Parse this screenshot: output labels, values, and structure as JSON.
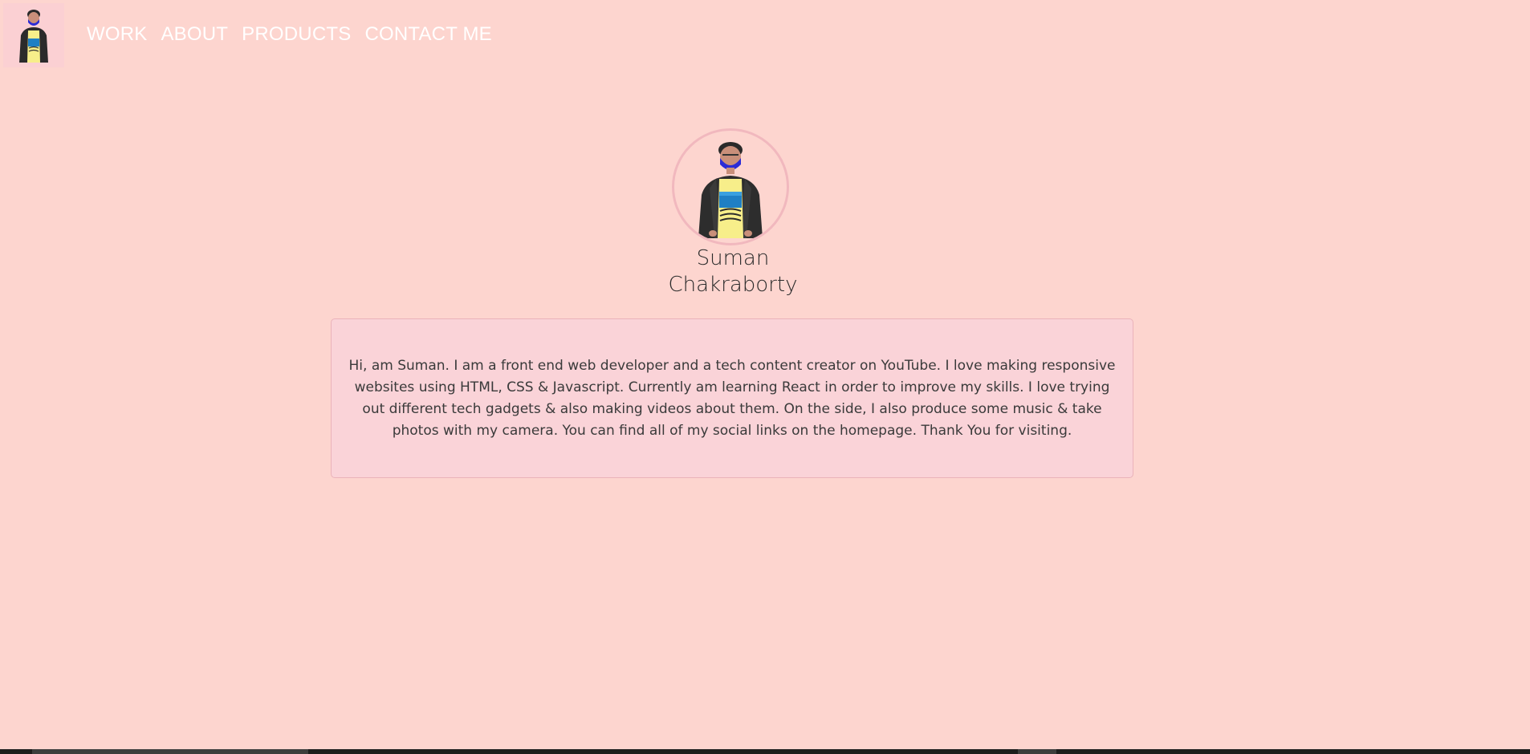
{
  "nav": {
    "logo_icon": "avatar-icon",
    "links": [
      {
        "label": "WORK"
      },
      {
        "label": "ABOUT"
      },
      {
        "label": "PRODUCTS"
      },
      {
        "label": "CONTACT ME"
      }
    ]
  },
  "profile": {
    "photo_icon": "avatar-icon",
    "name_line1": "Suman",
    "name_line2": "Chakraborty"
  },
  "bio": {
    "text": "Hi, am Suman. I am a front end web developer and a tech content creator on YouTube. I love making responsive websites using HTML, CSS & Javascript. Currently am learning React in order to improve my skills. I love trying out different tech gadgets & also making videos about them. On the side, I also produce some music & take photos with my camera. You can find all of my social links on the homepage. Thank You for visiting."
  },
  "colors": {
    "background": "#fdd5cf",
    "card_background": "#fad3d8",
    "card_border": "#eab3ba",
    "nav_text": "#ffffff",
    "photo_ring": "#f1b8be"
  }
}
